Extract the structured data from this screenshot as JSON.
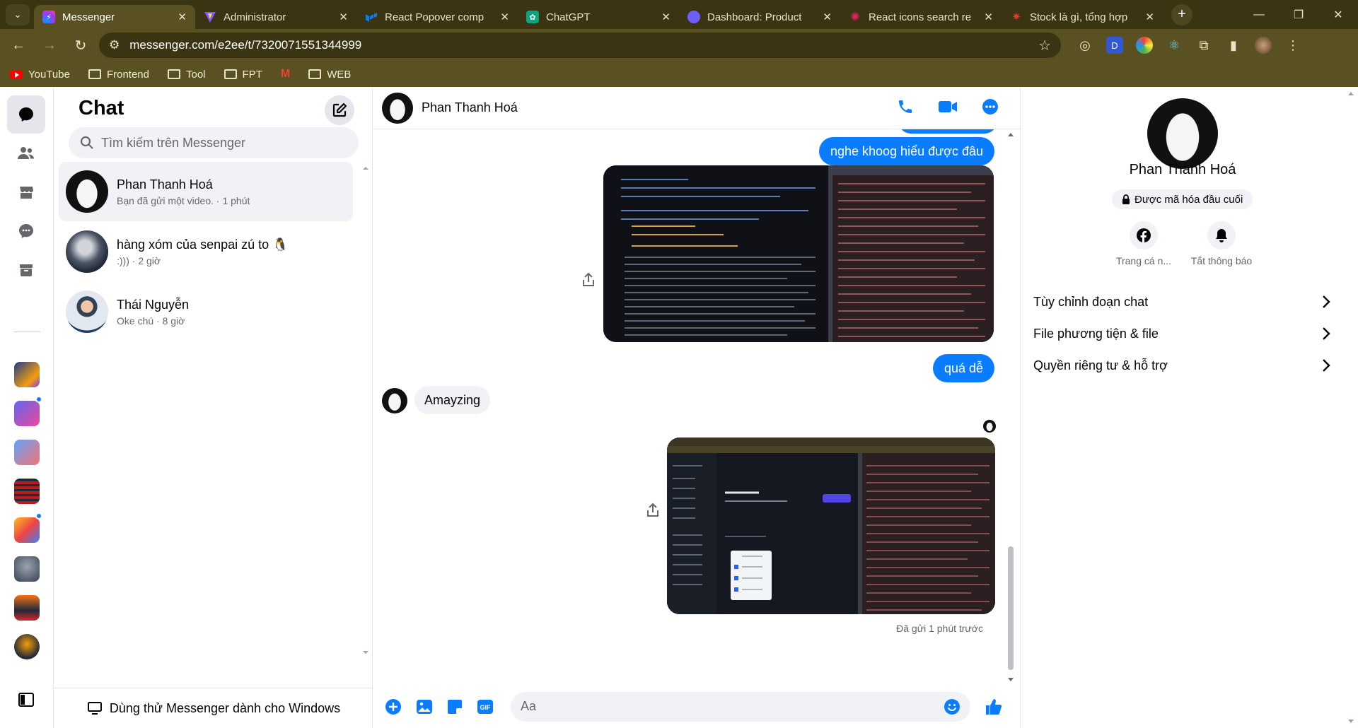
{
  "browser": {
    "tabs": [
      {
        "title": "Messenger",
        "icon_color": "#a334fa",
        "active": true
      },
      {
        "title": "Administrator",
        "icon_color": "#7b5cff",
        "active": false
      },
      {
        "title": "React Popover comp",
        "icon_color": "#007fff",
        "active": false
      },
      {
        "title": "ChatGPT",
        "icon_color": "#10a37f",
        "active": false
      },
      {
        "title": "Dashboard: Product",
        "icon_color": "#6d5dfc",
        "active": false
      },
      {
        "title": "React icons search re",
        "icon_color": "#e91e63",
        "active": false
      },
      {
        "title": "Stock là gì, tổng hợp",
        "icon_color": "#3b5bdb",
        "active": false
      }
    ],
    "url": "messenger.com/e2ee/t/7320071551344999",
    "bookmarks": [
      {
        "label": "YouTube",
        "icon": "youtube-icon"
      },
      {
        "label": "Frontend",
        "icon": "folder-icon"
      },
      {
        "label": "Tool",
        "icon": "folder-icon"
      },
      {
        "label": "FPT",
        "icon": "folder-icon"
      },
      {
        "label": "",
        "icon": "gmail-icon"
      },
      {
        "label": "WEB",
        "icon": "folder-icon"
      }
    ]
  },
  "chatlist": {
    "title": "Chat",
    "search_placeholder": "Tìm kiếm trên Messenger",
    "conversations": [
      {
        "name": "Phan Thanh Hoá",
        "preview": "Bạn đã gửi một video. · 1 phút"
      },
      {
        "name": "hàng xóm của senpai zú to 🐧",
        "preview": ":))) · 2 giờ"
      },
      {
        "name": "Thái Nguyễn",
        "preview": "Oke chú · 8 giờ"
      }
    ],
    "footer": "Dùng thử Messenger dành cho Windows"
  },
  "conversation": {
    "name": "Phan Thanh Hoá",
    "messages": {
      "out_1": "nghe khoog hiểu được đâu",
      "out_2": "quá dễ",
      "in_1": "Amayzing",
      "seen": "Đã gửi 1 phút trước"
    },
    "composer_placeholder": "Aa"
  },
  "info": {
    "name": "Phan Thanh Hoá",
    "e2e": "Được mã hóa đầu cuối",
    "actions": [
      {
        "label": "Trang cá n...",
        "icon": "facebook-icon"
      },
      {
        "label": "Tắt thông báo",
        "icon": "bell-icon"
      }
    ],
    "rows": [
      {
        "label": "Tùy chỉnh đoạn chat"
      },
      {
        "label": "File phương tiện & file"
      },
      {
        "label": "Quyền riêng tư & hỗ trợ"
      }
    ]
  },
  "colors": {
    "accent": "#0a7cff",
    "browser_frame": "#3a3412",
    "browser_toolbar": "#5a5122"
  }
}
